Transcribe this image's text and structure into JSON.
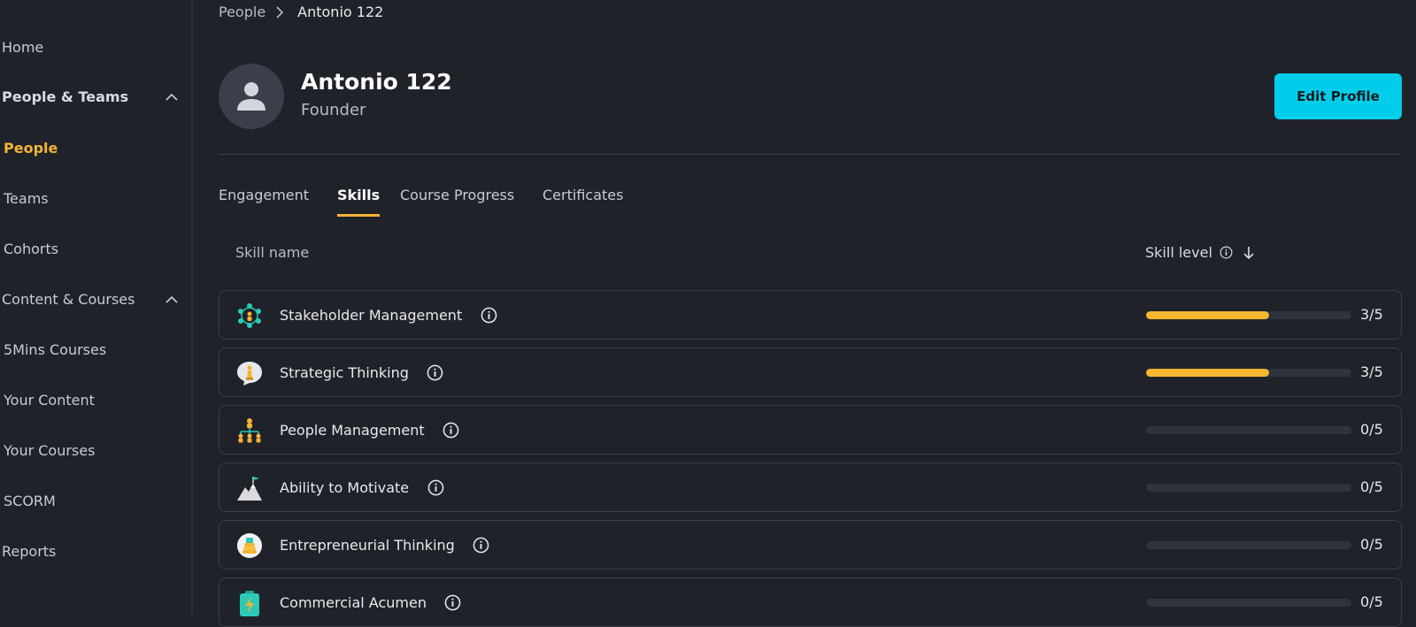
{
  "sidebar": {
    "items": [
      {
        "label": "Home",
        "name": "nav-home",
        "kind": "item"
      },
      {
        "label": "People & Teams",
        "name": "nav-people-teams",
        "kind": "group"
      },
      {
        "label": "People",
        "name": "nav-people",
        "kind": "sub-active"
      },
      {
        "label": "Teams",
        "name": "nav-teams",
        "kind": "sub"
      },
      {
        "label": "Cohorts",
        "name": "nav-cohorts",
        "kind": "sub"
      },
      {
        "label": "Content & Courses",
        "name": "nav-content-courses",
        "kind": "group-plain"
      },
      {
        "label": "5Mins Courses",
        "name": "nav-5mins-courses",
        "kind": "sub"
      },
      {
        "label": "Your Content",
        "name": "nav-your-content",
        "kind": "sub"
      },
      {
        "label": "Your Courses",
        "name": "nav-your-courses",
        "kind": "sub"
      },
      {
        "label": "SCORM",
        "name": "nav-scorm",
        "kind": "sub"
      },
      {
        "label": "Reports",
        "name": "nav-reports",
        "kind": "item"
      }
    ]
  },
  "breadcrumb": {
    "parent": "People",
    "current": "Antonio 122"
  },
  "profile": {
    "name": "Antonio 122",
    "role": "Founder",
    "edit_label": "Edit Profile"
  },
  "tabs": [
    {
      "label": "Engagement",
      "active": false
    },
    {
      "label": "Skills",
      "active": true
    },
    {
      "label": "Course Progress",
      "active": false
    },
    {
      "label": "Certificates",
      "active": false
    }
  ],
  "table": {
    "col_skill": "Skill name",
    "col_level": "Skill level",
    "rows": [
      {
        "name": "Stakeholder Management",
        "level": 3,
        "max": 5,
        "score": "3/5",
        "icon": "network-icon"
      },
      {
        "name": "Strategic Thinking",
        "level": 3,
        "max": 5,
        "score": "3/5",
        "icon": "chess-bubble-icon"
      },
      {
        "name": "People Management",
        "level": 0,
        "max": 5,
        "score": "0/5",
        "icon": "org-chart-icon"
      },
      {
        "name": "Ability to Motivate",
        "level": 0,
        "max": 5,
        "score": "0/5",
        "icon": "mountain-flag-icon"
      },
      {
        "name": "Entrepreneurial Thinking",
        "level": 0,
        "max": 5,
        "score": "0/5",
        "icon": "coin-stack-icon"
      },
      {
        "name": "Commercial Acumen",
        "level": 0,
        "max": 5,
        "score": "0/5",
        "icon": "battery-bolt-icon"
      }
    ]
  },
  "colors": {
    "accent": "#f5b335",
    "button": "#00cdea",
    "background": "#1f2229"
  }
}
